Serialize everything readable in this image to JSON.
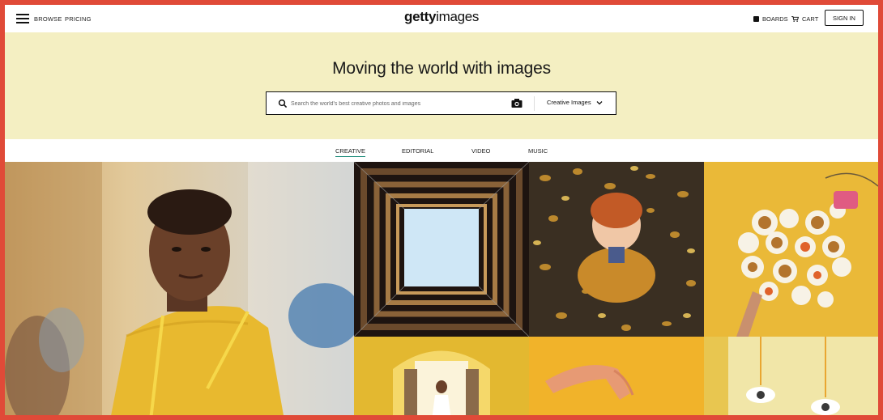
{
  "header": {
    "browse": "BROWSE",
    "pricing": "PRICING",
    "logo_bold": "getty",
    "logo_regular": "images",
    "boards": "BOARDS",
    "cart": "CART",
    "sign_in": "SIGN IN"
  },
  "hero": {
    "headline": "Moving the world with images",
    "search_placeholder": "Search the world's best creative photos and images",
    "search_type": "Creative Images",
    "background": "#f4efc2"
  },
  "tabs": [
    {
      "label": "CREATIVE",
      "active": true
    },
    {
      "label": "EDITORIAL",
      "active": false
    },
    {
      "label": "VIDEO",
      "active": false
    },
    {
      "label": "MUSIC",
      "active": false
    }
  ],
  "colors": {
    "frame_border": "#e04a38",
    "tab_active_underline": "#1a8a78"
  },
  "icons": [
    "menu-icon",
    "boards-icon",
    "cart-icon",
    "search-icon",
    "camera-icon",
    "chevron-down-icon"
  ]
}
